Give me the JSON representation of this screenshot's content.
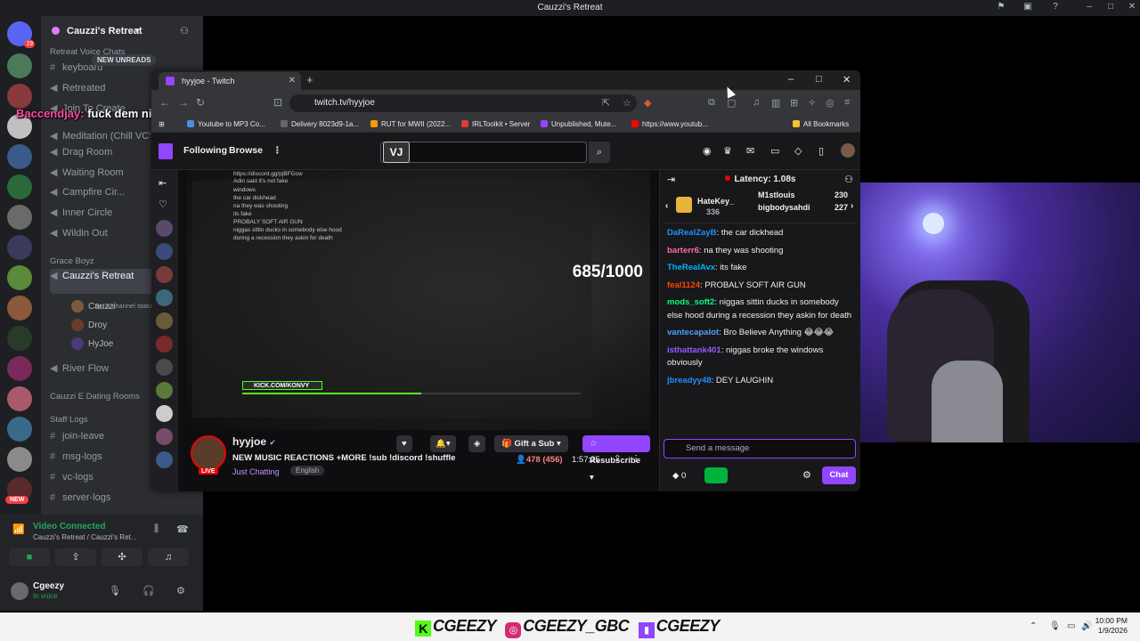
{
  "discord": {
    "window_title": "Cauzzi's Retreat",
    "server_name": "Cauzzi's Retreat",
    "new_unreads": "NEW UNREADS",
    "categories": {
      "retreat_voice": "Retreat Voice Chats",
      "grace_boyz": "Grace Boyz",
      "dating_rooms": "Cauzzi E Dating Rooms",
      "staff_logs": "Staff Logs"
    },
    "channels": {
      "keyboard": "keyboard",
      "retreated": "Retreated",
      "join_to_create": "Join To Create",
      "meditation": "Meditation (Chill VC's)",
      "drag_room": "Drag Room",
      "waiting_room": "Waiting Room",
      "campfire": "Campfire Cir...",
      "inner_circle": "Inner Circle",
      "wildin_out": "Wildin Out",
      "cauzzis_retreat": "Cauzzi's Retreat",
      "channel_status": "Set a channel status",
      "river_flow": "River Flow",
      "join_leave": "join-leave",
      "msg_logs": "msg-logs",
      "vc_logs": "vc-logs",
      "server_logs": "server-logs"
    },
    "members": [
      "Cauzzi",
      "Droy",
      "HyJoe"
    ],
    "rail_badges": [
      "19",
      "NEW"
    ],
    "overlay_user": "Baccendjay:",
    "overlay_msg": "fuck dem niggas",
    "voice": {
      "status": "Video Connected",
      "location": "Cauzzi's Retreat / Cauzzi's Ret...",
      "user": "Cgeezy",
      "user_status": "In voice"
    }
  },
  "browser": {
    "tab_title": "hyyjoe - Twitch",
    "url": "twitch.tv/hyyjoe",
    "bookmarks": [
      "Youtube to MP3 Co...",
      "Delivery 8023d9-1a...",
      "RUT for MWII (2022...",
      "IRLToolkit • Server",
      "Unpublished, Mute...",
      "https://www.youtub..."
    ],
    "all_bookmarks": "All Bookmarks"
  },
  "twitch": {
    "nav_following": "Following",
    "nav_browse": "Browse",
    "search_badge": "VJ",
    "player_counter": "685/1000",
    "player_kick": "KICK.COM/KONVY",
    "player_progress": 0.53,
    "player_lines": [
      "https://discord.gg/pjBFGcw",
      "Adin said it's not fake",
      "windows",
      "the car dickhead",
      "na they was shooting",
      "its fake",
      "PROBALY SOFT AIR GUN",
      "niggas sittin ducks in somebody else hood",
      "during a recession they askin for death"
    ],
    "streamer": "hyyjoe",
    "stream_title": "NEW MUSIC REACTIONS +MORE !sub !discord !shuffle",
    "category": "Just Chatting",
    "tag": "English",
    "gift_sub": "Gift a Sub",
    "resubscribe": "Resubscribe",
    "viewers": "478 (456)",
    "uptime": "1:57:25",
    "latency": "Latency: 1.08s",
    "gifters": [
      {
        "name": "HateKey_",
        "count": "336"
      },
      {
        "name": "M1stlouis",
        "count": "230"
      },
      {
        "name": "bigbodysahdi",
        "count": "227"
      }
    ],
    "chat": [
      {
        "user": "DaRealZayB",
        "color": "#1e90ff",
        "text": "the car dickhead"
      },
      {
        "user": "barterr6",
        "color": "#ff69b4",
        "text": "na they was shooting"
      },
      {
        "user": "TheRealAvx",
        "color": "#00b3ff",
        "text": "its fake"
      },
      {
        "user": "feal1124",
        "color": "#ff4500",
        "text": "PROBALY SOFT AIR GUN"
      },
      {
        "user": "mods_soft2",
        "color": "#00ff7f",
        "text": "niggas sittin ducks in somebody else hood during a recession they askin for death"
      },
      {
        "user": "vantecapalot",
        "color": "#4aa3ff",
        "text": "Bro Believe Anything 😂😂😂"
      },
      {
        "user": "isthattank401",
        "color": "#9b59ff",
        "text": "niggas broke the windows obviously"
      },
      {
        "user": "jbreadyy48",
        "color": "#1e90ff",
        "text": "DEY LAUGHIN"
      }
    ],
    "send_placeholder": "Send a message",
    "points": "0",
    "chat_button": "Chat"
  },
  "taskbar": {
    "handle_kick": "CGEEZY",
    "handle_ig": "CGEEZY_GBC",
    "handle_twitch": "CGEEZY",
    "time": "10:00 PM",
    "date": "1/9/2026"
  },
  "colors": {
    "twitch_purple": "#9146ff",
    "discord_bg": "#2b2d31",
    "kick_green": "#53fc18",
    "live_red": "#eb0400"
  }
}
